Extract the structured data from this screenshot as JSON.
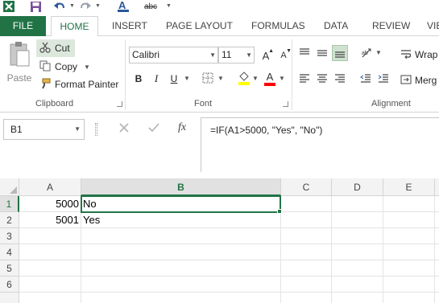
{
  "quick_access": {
    "icons": [
      "excel-logo-icon",
      "save-icon",
      "undo-icon",
      "redo-icon",
      "font-color-icon",
      "spelling-icon"
    ],
    "spelling_label": "abc"
  },
  "tabs": {
    "file": "FILE",
    "home": "HOME",
    "insert": "INSERT",
    "page_layout": "PAGE LAYOUT",
    "formulas": "FORMULAS",
    "data": "DATA",
    "review": "REVIEW",
    "view": "VIE"
  },
  "clipboard": {
    "paste": "Paste",
    "cut": "Cut",
    "copy": "Copy",
    "format_painter": "Format Painter",
    "group_label": "Clipboard"
  },
  "font": {
    "name": "Calibri",
    "size": "11",
    "bold": "B",
    "italic": "I",
    "underline": "U",
    "font_color_letter": "A",
    "grow_letter": "A",
    "shrink_letter": "A",
    "group_label": "Font",
    "colors": {
      "highlight": "#ffff00",
      "font": "#ff0000"
    }
  },
  "alignment": {
    "wrap": "Wrap",
    "merge": "Merg",
    "group_label": "Alignment"
  },
  "formula_bar": {
    "name_box": "B1",
    "fx": "fx",
    "formula": "=IF(A1>5000, \"Yes\", \"No\")"
  },
  "sheet": {
    "columns": [
      "A",
      "B",
      "C",
      "D",
      "E"
    ],
    "selected_column": "B",
    "rows": [
      "1",
      "2",
      "3",
      "4",
      "5",
      "6"
    ],
    "selected_row": "1",
    "cells": {
      "A1": "5000",
      "B1": "No",
      "A2": "5001",
      "B2": "Yes"
    }
  },
  "colors": {
    "accent": "#217346",
    "header_bg": "#f3f3f3",
    "selected_header_bg": "#e1e1e1"
  }
}
